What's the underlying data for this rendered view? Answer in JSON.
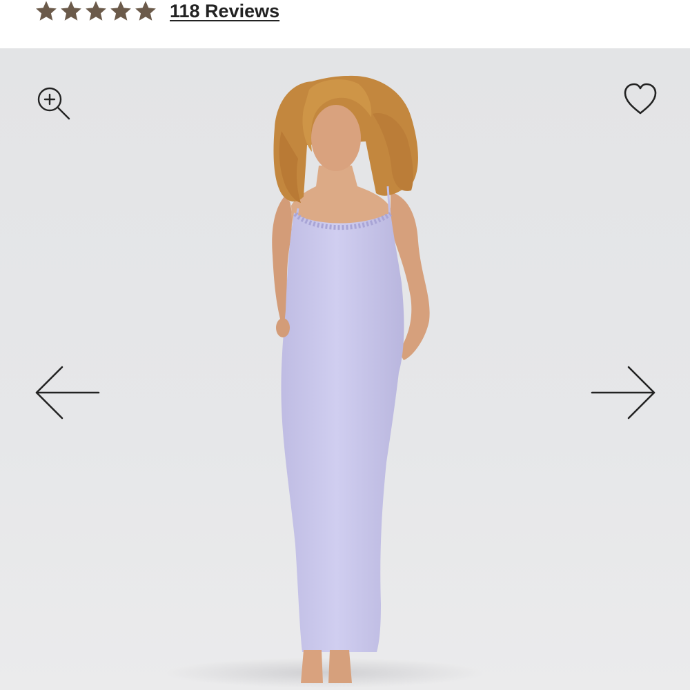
{
  "rating": {
    "value": 5,
    "max": 5,
    "star_color": "#6b5a4a",
    "reviews_label": "118 Reviews"
  },
  "gallery": {
    "background_color": "#e4e5e7",
    "product_color": "#c9c7ea",
    "hair_color": "#c98a3e",
    "skin_color": "#d9a27e",
    "icons": {
      "zoom": "zoom-in-icon",
      "wishlist": "heart-icon",
      "prev": "arrow-left-icon",
      "next": "arrow-right-icon"
    }
  }
}
